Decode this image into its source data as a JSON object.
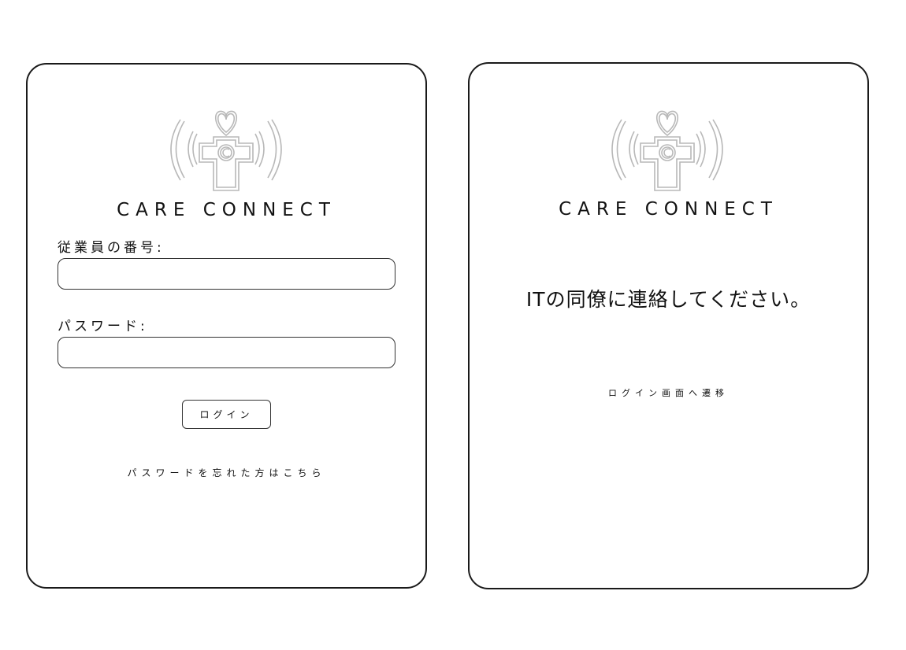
{
  "login_screen": {
    "brand": "CARE CONNECT",
    "logo_icon": "care-connect-logo",
    "employee_number_label": "従業員の番号:",
    "employee_number_value": "",
    "password_label": "パスワード:",
    "password_value": "",
    "login_button": "ログイン",
    "forgot_password_link": "パスワードを忘れた方はこちら"
  },
  "contact_screen": {
    "brand": "CARE CONNECT",
    "logo_icon": "care-connect-logo",
    "message": "ITの同僚に連絡してください。",
    "back_link": "ログイン画面へ遷移"
  },
  "colors": {
    "border": "#1a1a1a",
    "logo_outline": "#b8b8b8",
    "text": "#111111",
    "background": "#ffffff"
  }
}
